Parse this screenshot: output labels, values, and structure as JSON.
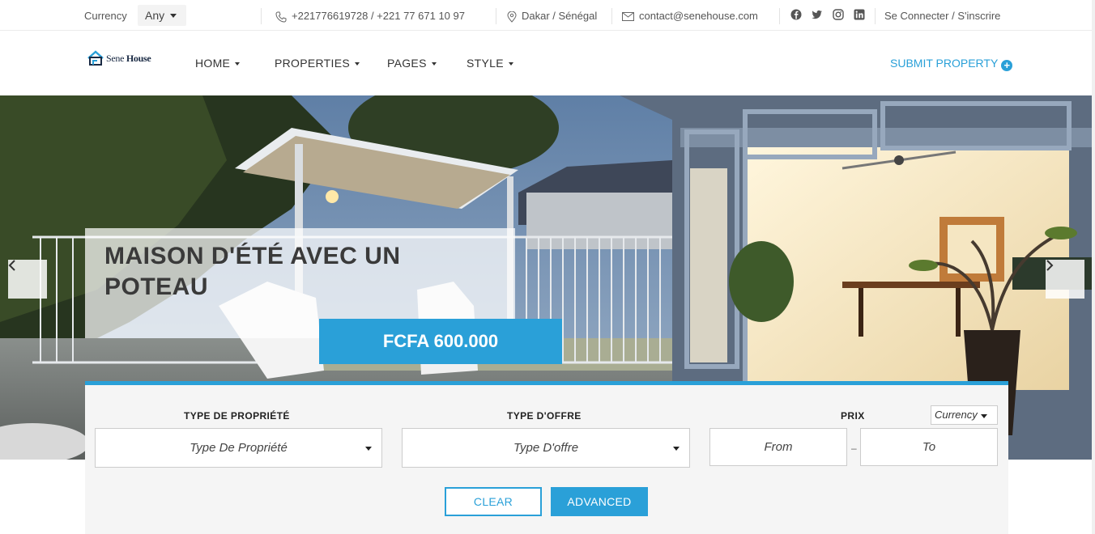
{
  "topbar": {
    "currency_label": "Currency",
    "currency_value": "Any",
    "phone": "+221776619728 / +221 77 671 10 97",
    "address": "Dakar / Sénégal",
    "email": "contact@senehouse.com",
    "socials": [
      "facebook-icon",
      "twitter-icon",
      "instagram-icon",
      "linkedin-icon"
    ],
    "login": "Se Connecter / S'inscrire"
  },
  "nav": {
    "logo_text_a": "Sene",
    "logo_text_b": " House",
    "items": [
      {
        "label": "HOME"
      },
      {
        "label": "PROPERTIES"
      },
      {
        "label": "PAGES"
      },
      {
        "label": "STYLE"
      }
    ],
    "submit": "SUBMIT PROPERTY"
  },
  "hero": {
    "title": "MAISON D'ÉTÉ AVEC UN POTEAU",
    "price": "FCFA 600.000"
  },
  "search": {
    "type_label": "TYPE DE PROPRIÉTÉ",
    "type_value": "Type De Propriété",
    "offer_label": "TYPE D'OFFRE",
    "offer_value": "Type D'offre",
    "price_label": "PRIX",
    "currency": "Currency",
    "from": "From",
    "to": "To",
    "dash": "–",
    "clear": "CLEAR",
    "advanced": "ADVANCED"
  },
  "colors": {
    "accent": "#2aa0d8"
  }
}
